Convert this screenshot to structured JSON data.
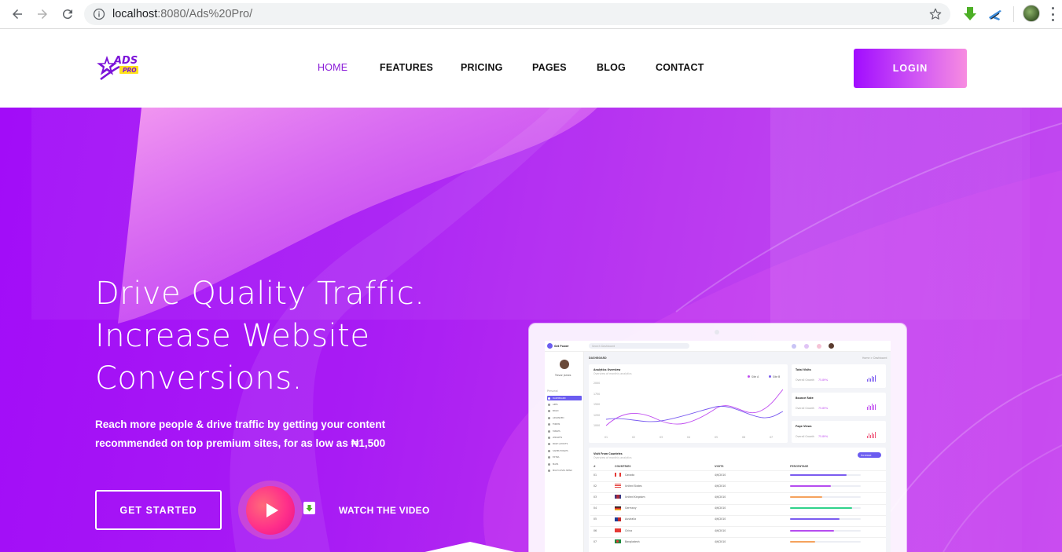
{
  "browser": {
    "url_host": "localhost",
    "url_rest": ":8080/Ads%20Pro/"
  },
  "header": {
    "logo_text_top": "ADS",
    "logo_text_badge": "PRO",
    "nav": [
      {
        "label": "HOME",
        "active": true
      },
      {
        "label": "FEATURES",
        "active": false
      },
      {
        "label": "PRICING",
        "active": false
      },
      {
        "label": "PAGES",
        "active": false
      },
      {
        "label": "BLOG",
        "active": false
      },
      {
        "label": "CONTACT",
        "active": false
      }
    ],
    "login_label": "LOGIN"
  },
  "hero": {
    "title_lines": [
      "Drive Quality Traffic.",
      "Increase Website",
      "Conversions."
    ],
    "subtitle_line1": "Reach more people & drive traffic by getting your content",
    "subtitle_line2": "recommended on top premium sites, for as low as ₦1,500",
    "cta_label": "GET STARTED",
    "video_label": "WATCH THE VIDEO"
  },
  "mockup": {
    "brand": "Get Power",
    "search_placeholder": "Search Dashboard",
    "user_name": "Trevor James",
    "section_label": "Personal",
    "menu": [
      "DASHBOARD",
      "APPS",
      "BASIC",
      "ADVANCED",
      "FORMS",
      "TABLES",
      "WIDGETS",
      "PAGE LAYOUTS",
      "SAMPLE PAGES",
      "EXTRA",
      "MAPS",
      "MULTI LEVEL MENU"
    ],
    "breadcrumb_title": "DASHBOARD",
    "breadcrumb_path": "Home  >  Dashboard",
    "analytics_title": "Analytics Overview",
    "analytics_sub": "Overview of monthly analytics",
    "legend": [
      "Site A",
      "Site B"
    ],
    "y_ticks": [
      "2000",
      "1750",
      "1500",
      "1250",
      "1000"
    ],
    "x_ticks": [
      "01",
      "02",
      "03",
      "04",
      "05",
      "06",
      "07"
    ],
    "stats": [
      {
        "title": "Total Visits",
        "growth_label": "Overall Growth",
        "growth": "75.89%"
      },
      {
        "title": "Bounce Rate",
        "growth_label": "Overall Growth",
        "growth": "75.89%"
      },
      {
        "title": "Page Views",
        "growth_label": "Overall Growth",
        "growth": "75.89%"
      }
    ],
    "countries_title": "Visit From Countries",
    "countries_sub": "Overview of monthly analytics",
    "countries_button": "Increase",
    "table_headers": [
      "#",
      "COUNTRIES",
      "VISITS",
      "PERCENTAGE"
    ],
    "rows": [
      {
        "n": "01",
        "country": "Canada",
        "visits": "4/6/2010",
        "pct": 0.8,
        "color": "#7b5cf0"
      },
      {
        "n": "02",
        "country": "United States",
        "visits": "4/6/2010",
        "pct": 0.58,
        "color": "#b64cf0"
      },
      {
        "n": "03",
        "country": "United Kingdom",
        "visits": "4/6/2010",
        "pct": 0.45,
        "color": "#f5a25d"
      },
      {
        "n": "04",
        "country": "Germany",
        "visits": "4/6/2010",
        "pct": 0.88,
        "color": "#30d28a"
      },
      {
        "n": "05",
        "country": "Australia",
        "visits": "4/6/2010",
        "pct": 0.7,
        "color": "#7b5cf0"
      },
      {
        "n": "06",
        "country": "China",
        "visits": "4/6/2010",
        "pct": 0.62,
        "color": "#b64cf0"
      },
      {
        "n": "07",
        "country": "Bangladesh",
        "visits": "4/6/2010",
        "pct": 0.35,
        "color": "#f5a25d"
      }
    ]
  },
  "colors": {
    "brand_purple": "#a20cf8",
    "nav_active": "#8a1bd8",
    "play_pink": "#ff2f8a"
  }
}
